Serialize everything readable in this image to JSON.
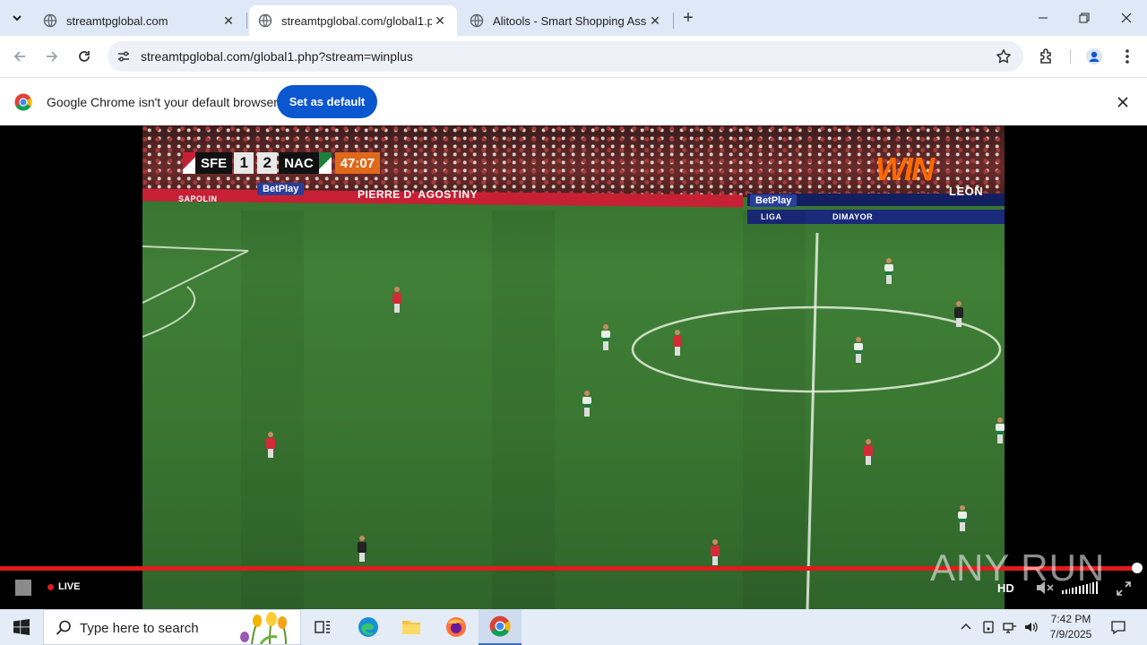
{
  "tabs": [
    {
      "title": "streamtpglobal.com",
      "active": false
    },
    {
      "title": "streamtpglobal.com/global1.php?stream=winplus",
      "active": true
    },
    {
      "title": "Alitools - Smart Shopping Assistant",
      "active": false
    }
  ],
  "toolbar": {
    "url": "streamtpglobal.com/global1.php?stream=winplus"
  },
  "infobar": {
    "message": "Google Chrome isn't your default browser",
    "set_default_label": "Set as default"
  },
  "video": {
    "scorebug": {
      "home_team": "SFE",
      "home_score": "1",
      "away_score": "2",
      "away_team": "NAC",
      "match_clock": "47:07"
    },
    "broadcaster_logo": "WIN",
    "ads": [
      "BetPlay",
      "PIERRE D' AGOSTINY",
      "SAPOLIN",
      "LIGA",
      "BetPlay",
      "DIMAYOR",
      "LEON"
    ]
  },
  "player_controls": {
    "live_label": "LIVE",
    "quality_label": "HD",
    "progress": 0.99
  },
  "watermark": "ANY RUN",
  "taskbar": {
    "search_placeholder": "Type here to search",
    "time": "7:42 PM",
    "date": "7/9/2025"
  },
  "colors": {
    "accent": "#0b57d0",
    "progress": "#e01b1b",
    "tabstrip": "#dfe8f6"
  }
}
